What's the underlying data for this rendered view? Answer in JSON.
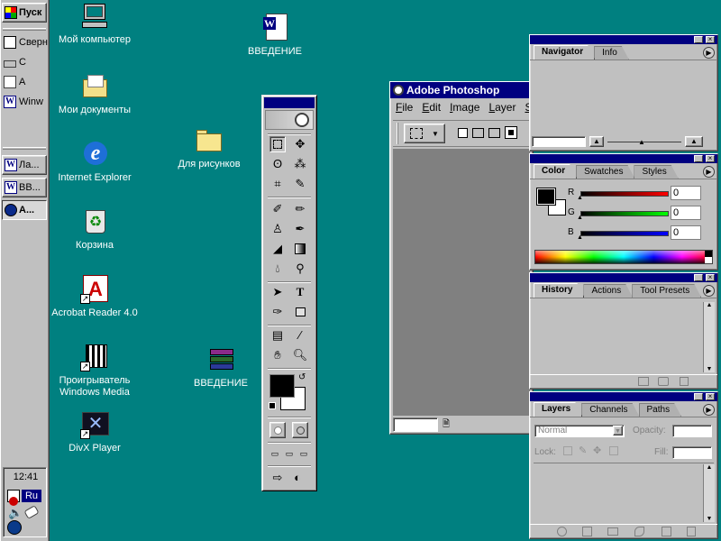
{
  "taskbar": {
    "start_label": "Пуск",
    "quick_launch": [
      {
        "label": "Сверн"
      },
      {
        "label": "С"
      },
      {
        "label": "А"
      },
      {
        "label": "Winw"
      }
    ],
    "tasks": [
      {
        "label": "Ла..."
      },
      {
        "label": "ВВ..."
      },
      {
        "label": "А..."
      }
    ],
    "clock": "12:41",
    "lang": "Ru"
  },
  "desktop_icons": [
    {
      "label": "Мой компьютер",
      "icon": "my-computer-icon"
    },
    {
      "label": "Мои документы",
      "icon": "my-documents-icon"
    },
    {
      "label": "Internet Explorer",
      "icon": "internet-explorer-icon"
    },
    {
      "label": "Корзина",
      "icon": "recycle-bin-icon"
    },
    {
      "label": "Acrobat Reader 4.0",
      "icon": "acrobat-icon"
    },
    {
      "label": "Проигрыватель Windows Media",
      "icon": "media-player-icon"
    },
    {
      "label": "DivX Player",
      "icon": "divx-icon"
    },
    {
      "label": "ВВЕДЕНИЕ",
      "icon": "word-document-icon"
    },
    {
      "label": "Для рисунков",
      "icon": "folder-icon"
    },
    {
      "label": "ВВЕДЕНИЕ",
      "icon": "winrar-icon"
    }
  ],
  "photoshop": {
    "title": "Adobe Photoshop",
    "menu": [
      "File",
      "Edit",
      "Image",
      "Layer",
      "S"
    ]
  },
  "palettes": {
    "navigator": {
      "tabs": [
        "Navigator",
        "Info"
      ]
    },
    "color": {
      "tabs": [
        "Color",
        "Swatches",
        "Styles"
      ],
      "channels": [
        {
          "label": "R",
          "value": "0"
        },
        {
          "label": "G",
          "value": "0"
        },
        {
          "label": "B",
          "value": "0"
        }
      ]
    },
    "history": {
      "tabs": [
        "History",
        "Actions",
        "Tool Presets"
      ]
    },
    "layers": {
      "tabs": [
        "Layers",
        "Channels",
        "Paths"
      ],
      "blend_mode": "Normal",
      "opacity_label": "Opacity:",
      "lock_label": "Lock:",
      "fill_label": "Fill:"
    }
  },
  "colors": {
    "desktop": "#008080",
    "title_active": "#000080"
  }
}
